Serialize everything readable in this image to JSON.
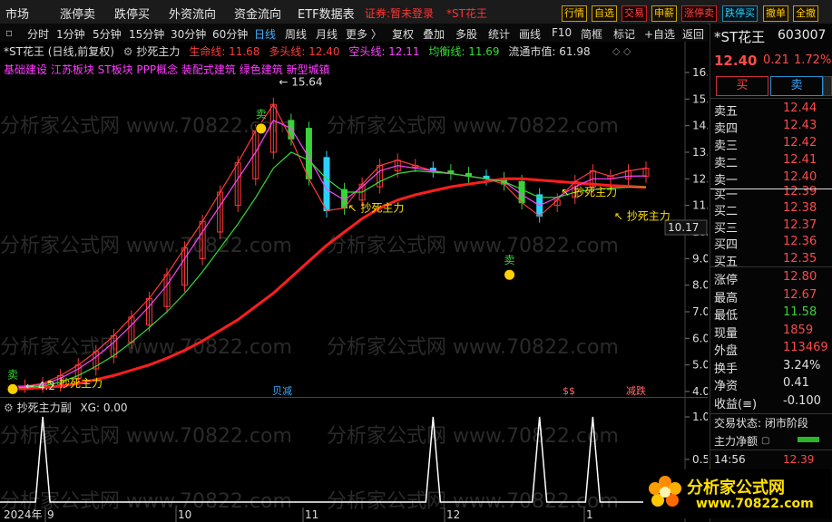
{
  "topmenu": {
    "items": [
      "市场",
      "涨停卖",
      "跌停买",
      "外资流向",
      "资金流向",
      "ETF数据表"
    ],
    "status": "证券:暂未登录",
    "stock_tag": "*ST花王",
    "right_buttons": [
      "行情",
      "自选",
      "交易",
      "申薪",
      "涨停卖",
      "跌停买",
      "撤单",
      "全撤"
    ]
  },
  "periodbar": {
    "items": [
      "分时",
      "1分钟",
      "5分钟",
      "15分钟",
      "30分钟",
      "60分钟",
      "日线",
      "周线",
      "月线",
      "更多 〉",
      "复权",
      "叠加",
      "多股",
      "统计",
      "画线",
      "F10",
      "简框",
      "标记",
      "+自选",
      "返回"
    ],
    "active": "日线"
  },
  "chart_info": {
    "title": "*ST花王 (日线,前复权)",
    "indicator": "抄死主力",
    "lines": [
      {
        "label": "生命线: 11.68",
        "color": "#ff3b3b"
      },
      {
        "label": "多头线: 12.40",
        "color": "#ff3b3b"
      },
      {
        "label": "空头线: 12.11",
        "color": "#ff44ff"
      },
      {
        "label": "均衡线: 11.69",
        "color": "#33dd33"
      }
    ],
    "market_cap": "流通市值: 61.98",
    "concepts": "基础建设 江苏板块 ST板块 PPP概念 装配式建筑 绿色建筑 新型城镇"
  },
  "chart_labels": {
    "high": "15.64",
    "low": "4.2",
    "last_price_tag": "10.17",
    "signal_text": "抄死主力",
    "sell_text": "卖",
    "event_labels": [
      "贝减",
      "$",
      "$",
      "减跌"
    ]
  },
  "subchart": {
    "title": "抄死主力副",
    "xg": "XG: 0.00"
  },
  "x_axis": [
    "2024年",
    "9",
    "10",
    "11",
    "12",
    "1"
  ],
  "watermark": "分析家公式网  www.70822.com",
  "rightpanel": {
    "name": "*ST花王",
    "code": "603007",
    "price": "12.40",
    "change": "0.21",
    "change_pct": "1.72%",
    "buy_btn": "买",
    "sell_btn": "卖",
    "asks": [
      {
        "label": "卖五",
        "price": "12.44"
      },
      {
        "label": "卖四",
        "price": "12.43"
      },
      {
        "label": "卖三",
        "price": "12.42"
      },
      {
        "label": "卖二",
        "price": "12.41"
      },
      {
        "label": "卖一",
        "price": "12.40"
      }
    ],
    "bids": [
      {
        "label": "买一",
        "price": "12.39"
      },
      {
        "label": "买二",
        "price": "12.38"
      },
      {
        "label": "买三",
        "price": "12.37"
      },
      {
        "label": "买四",
        "price": "12.36"
      },
      {
        "label": "买五",
        "price": "12.35"
      }
    ],
    "stats": [
      {
        "label": "涨停",
        "value": "12.80"
      },
      {
        "label": "最高",
        "value": "12.67"
      },
      {
        "label": "最低",
        "value": "11.58"
      },
      {
        "label": "现量",
        "value": "1859"
      },
      {
        "label": "外盘",
        "value": "113469"
      },
      {
        "label": "换手",
        "value": "3.24%"
      },
      {
        "label": "净资",
        "value": "0.41"
      },
      {
        "label": "收益(≡)",
        "value": "-0.100"
      }
    ],
    "trade_status": "交易状态: 闭市阶段",
    "main_net": "主力净额",
    "last_time": "14:56",
    "last_price": "12.39",
    "logo_text": "分析家公式网",
    "logo_url": "www.70822.com"
  },
  "chart_data": {
    "type": "line",
    "x": [
      "2024-08-15",
      "2024-08-19",
      "2024-08-22",
      "2024-08-27",
      "2024-08-30",
      "2024-09-04",
      "2024-09-09",
      "2024-09-13",
      "2024-09-19",
      "2024-09-24",
      "2024-09-27",
      "2024-10-09",
      "2024-10-12",
      "2024-10-17",
      "2024-10-22",
      "2024-10-25",
      "2024-10-30",
      "2024-11-04",
      "2024-11-07",
      "2024-11-12",
      "2024-11-15",
      "2024-11-20",
      "2024-11-25",
      "2024-11-28",
      "2024-12-03",
      "2024-12-06",
      "2024-12-11",
      "2024-12-16",
      "2024-12-19",
      "2024-12-24",
      "2024-12-27",
      "2025-01-02",
      "2025-01-07",
      "2025-01-10",
      "2025-01-15",
      "2025-01-20",
      "2025-01-23"
    ],
    "series": [
      {
        "name": "生命线",
        "values": [
          4.1,
          4.1,
          4.15,
          4.2,
          4.3,
          4.45,
          4.6,
          4.8,
          5.0,
          5.25,
          5.55,
          5.9,
          6.3,
          6.7,
          7.2,
          7.7,
          8.3,
          8.9,
          9.5,
          10.0,
          10.5,
          10.9,
          11.2,
          11.4,
          11.55,
          11.7,
          11.8,
          11.9,
          12.0,
          12.0,
          11.95,
          11.9,
          11.85,
          11.8,
          11.75,
          11.72,
          11.68
        ]
      },
      {
        "name": "多头线",
        "values": [
          4.2,
          4.2,
          4.3,
          4.6,
          5.0,
          5.5,
          6.1,
          6.8,
          7.5,
          8.4,
          9.4,
          10.4,
          11.5,
          12.6,
          13.8,
          14.8,
          13.5,
          12.0,
          10.8,
          10.9,
          11.8,
          12.5,
          12.7,
          12.5,
          12.3,
          12.2,
          12.1,
          12.0,
          11.8,
          11.1,
          10.6,
          11.2,
          11.9,
          12.3,
          12.1,
          12.3,
          12.4
        ]
      },
      {
        "name": "空头线",
        "values": [
          4.2,
          4.2,
          4.25,
          4.5,
          4.85,
          5.3,
          5.85,
          6.5,
          7.2,
          8.0,
          9.0,
          10.0,
          11.0,
          12.0,
          13.0,
          14.2,
          13.9,
          12.8,
          11.6,
          11.2,
          11.7,
          12.3,
          12.5,
          12.4,
          12.3,
          12.2,
          12.1,
          12.0,
          11.9,
          11.4,
          11.0,
          11.3,
          11.7,
          12.0,
          12.0,
          12.1,
          12.11
        ]
      },
      {
        "name": "均衡线",
        "values": [
          4.15,
          4.15,
          4.2,
          4.35,
          4.6,
          4.95,
          5.35,
          5.85,
          6.4,
          7.0,
          7.7,
          8.5,
          9.4,
          10.3,
          11.3,
          12.4,
          13.0,
          12.7,
          12.0,
          11.5,
          11.5,
          11.9,
          12.2,
          12.3,
          12.25,
          12.2,
          12.1,
          12.0,
          11.9,
          11.6,
          11.3,
          11.3,
          11.5,
          11.6,
          11.65,
          11.68,
          11.69
        ]
      }
    ],
    "ylim": [
      4.0,
      16.0
    ],
    "y_ticks": [
      4.0,
      5.0,
      6.0,
      7.0,
      8.0,
      9.0,
      10.0,
      11.0,
      12.0,
      13.0,
      14.0,
      15.0,
      16.0
    ],
    "sub_series": {
      "name": "抄死主力副",
      "spikes_at": [
        "2024-08-22",
        "2024-12-03",
        "2024-12-27",
        "2025-01-10"
      ],
      "ylim": [
        0,
        1
      ],
      "y_ticks": [
        0.0,
        0.5,
        1.0
      ]
    }
  }
}
